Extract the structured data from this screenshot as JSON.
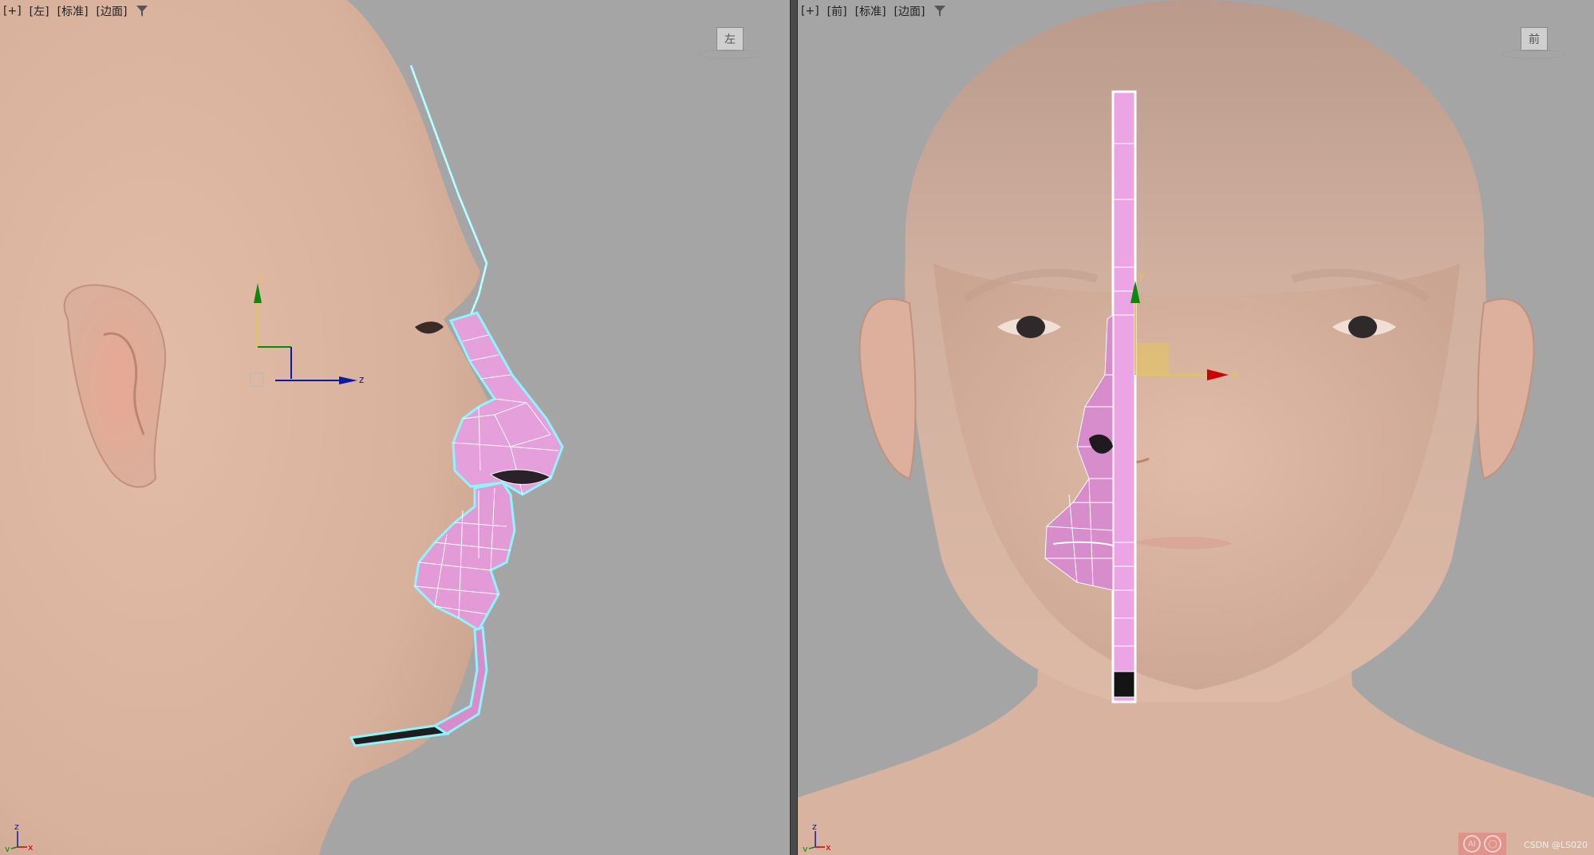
{
  "left_viewport": {
    "labels": [
      "+",
      "左",
      "标准",
      "边面"
    ],
    "viewcube_label": "左",
    "gizmo_axes": [
      "y",
      "z"
    ],
    "tripod_axes": [
      "z",
      "y",
      "x"
    ]
  },
  "right_viewport": {
    "labels": [
      "+",
      "前",
      "标准",
      "边面"
    ],
    "viewcube_label": "前",
    "gizmo_axes": [
      "y",
      "x"
    ],
    "tripod_axes": [
      "z",
      "y",
      "x"
    ]
  },
  "footer": {
    "watermark": "CSDN @LS020",
    "ai_badges": [
      "AI",
      "◯"
    ]
  },
  "colors": {
    "viewport_bg": "#a5a5a5",
    "skin": "#dcb6a2",
    "mesh_fill": "#e59fdb",
    "mesh_edge": "#ffffff",
    "selection_outline": "#8ff4ff",
    "axis_x": "#cc0000",
    "axis_y": "#0a8a0a",
    "axis_z": "#0a1aa8",
    "gizmo_plane": "#e3c65a"
  },
  "icons": {
    "filter": "filter-icon",
    "viewcube": "viewcube-icon"
  }
}
